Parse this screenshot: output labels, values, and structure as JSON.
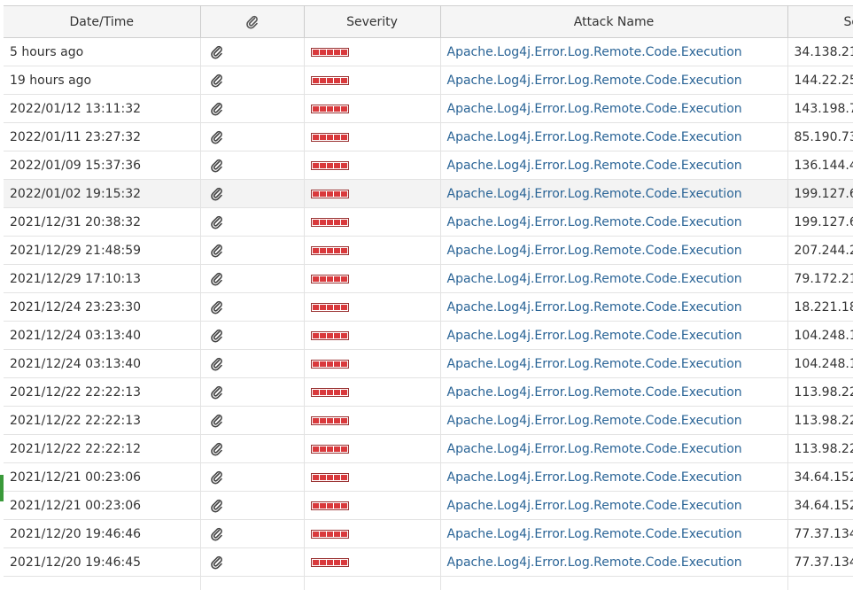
{
  "columns": {
    "datetime": "Date/Time",
    "attachment_icon": "paperclip-icon",
    "severity": "Severity",
    "attack": "Attack Name",
    "source_partial": "So"
  },
  "colors": {
    "severity_red": "#d9393c",
    "link_blue": "#2a6496",
    "marker_green": "#3a9a3a"
  },
  "rows": [
    {
      "datetime": "5 hours ago",
      "severity_level": 5,
      "attack": "Apache.Log4j.Error.Log.Remote.Code.Execution",
      "source": "34.138.21"
    },
    {
      "datetime": "19 hours ago",
      "severity_level": 5,
      "attack": "Apache.Log4j.Error.Log.Remote.Code.Execution",
      "source": "144.22.25"
    },
    {
      "datetime": "2022/01/12 13:11:32",
      "severity_level": 5,
      "attack": "Apache.Log4j.Error.Log.Remote.Code.Execution",
      "source": "143.198.7"
    },
    {
      "datetime": "2022/01/11 23:27:32",
      "severity_level": 5,
      "attack": "Apache.Log4j.Error.Log.Remote.Code.Execution",
      "source": "85.190.73"
    },
    {
      "datetime": "2022/01/09 15:37:36",
      "severity_level": 5,
      "attack": "Apache.Log4j.Error.Log.Remote.Code.Execution",
      "source": "136.144.4"
    },
    {
      "datetime": "2022/01/02 19:15:32",
      "severity_level": 5,
      "attack": "Apache.Log4j.Error.Log.Remote.Code.Execution",
      "source": "199.127.6"
    },
    {
      "datetime": "2021/12/31 20:38:32",
      "severity_level": 5,
      "attack": "Apache.Log4j.Error.Log.Remote.Code.Execution",
      "source": "199.127.6"
    },
    {
      "datetime": "2021/12/29 21:48:59",
      "severity_level": 5,
      "attack": "Apache.Log4j.Error.Log.Remote.Code.Execution",
      "source": "207.244.2"
    },
    {
      "datetime": "2021/12/29 17:10:13",
      "severity_level": 5,
      "attack": "Apache.Log4j.Error.Log.Remote.Code.Execution",
      "source": "79.172.21"
    },
    {
      "datetime": "2021/12/24 23:23:30",
      "severity_level": 5,
      "attack": "Apache.Log4j.Error.Log.Remote.Code.Execution",
      "source": "18.221.18"
    },
    {
      "datetime": "2021/12/24 03:13:40",
      "severity_level": 5,
      "attack": "Apache.Log4j.Error.Log.Remote.Code.Execution",
      "source": "104.248.1"
    },
    {
      "datetime": "2021/12/24 03:13:40",
      "severity_level": 5,
      "attack": "Apache.Log4j.Error.Log.Remote.Code.Execution",
      "source": "104.248.1"
    },
    {
      "datetime": "2021/12/22 22:22:13",
      "severity_level": 5,
      "attack": "Apache.Log4j.Error.Log.Remote.Code.Execution",
      "source": "113.98.22"
    },
    {
      "datetime": "2021/12/22 22:22:13",
      "severity_level": 5,
      "attack": "Apache.Log4j.Error.Log.Remote.Code.Execution",
      "source": "113.98.22"
    },
    {
      "datetime": "2021/12/22 22:22:12",
      "severity_level": 5,
      "attack": "Apache.Log4j.Error.Log.Remote.Code.Execution",
      "source": "113.98.22"
    },
    {
      "datetime": "2021/12/21 00:23:06",
      "severity_level": 5,
      "attack": "Apache.Log4j.Error.Log.Remote.Code.Execution",
      "source": "34.64.152"
    },
    {
      "datetime": "2021/12/21 00:23:06",
      "severity_level": 5,
      "attack": "Apache.Log4j.Error.Log.Remote.Code.Execution",
      "source": "34.64.152"
    },
    {
      "datetime": "2021/12/20 19:46:46",
      "severity_level": 5,
      "attack": "Apache.Log4j.Error.Log.Remote.Code.Execution",
      "source": "77.37.134"
    },
    {
      "datetime": "2021/12/20 19:46:45",
      "severity_level": 5,
      "attack": "Apache.Log4j.Error.Log.Remote.Code.Execution",
      "source": "77.37.134"
    },
    {
      "datetime": "",
      "severity_level": 0,
      "attack": "",
      "source": ""
    }
  ],
  "highlighted_row_index": 5
}
